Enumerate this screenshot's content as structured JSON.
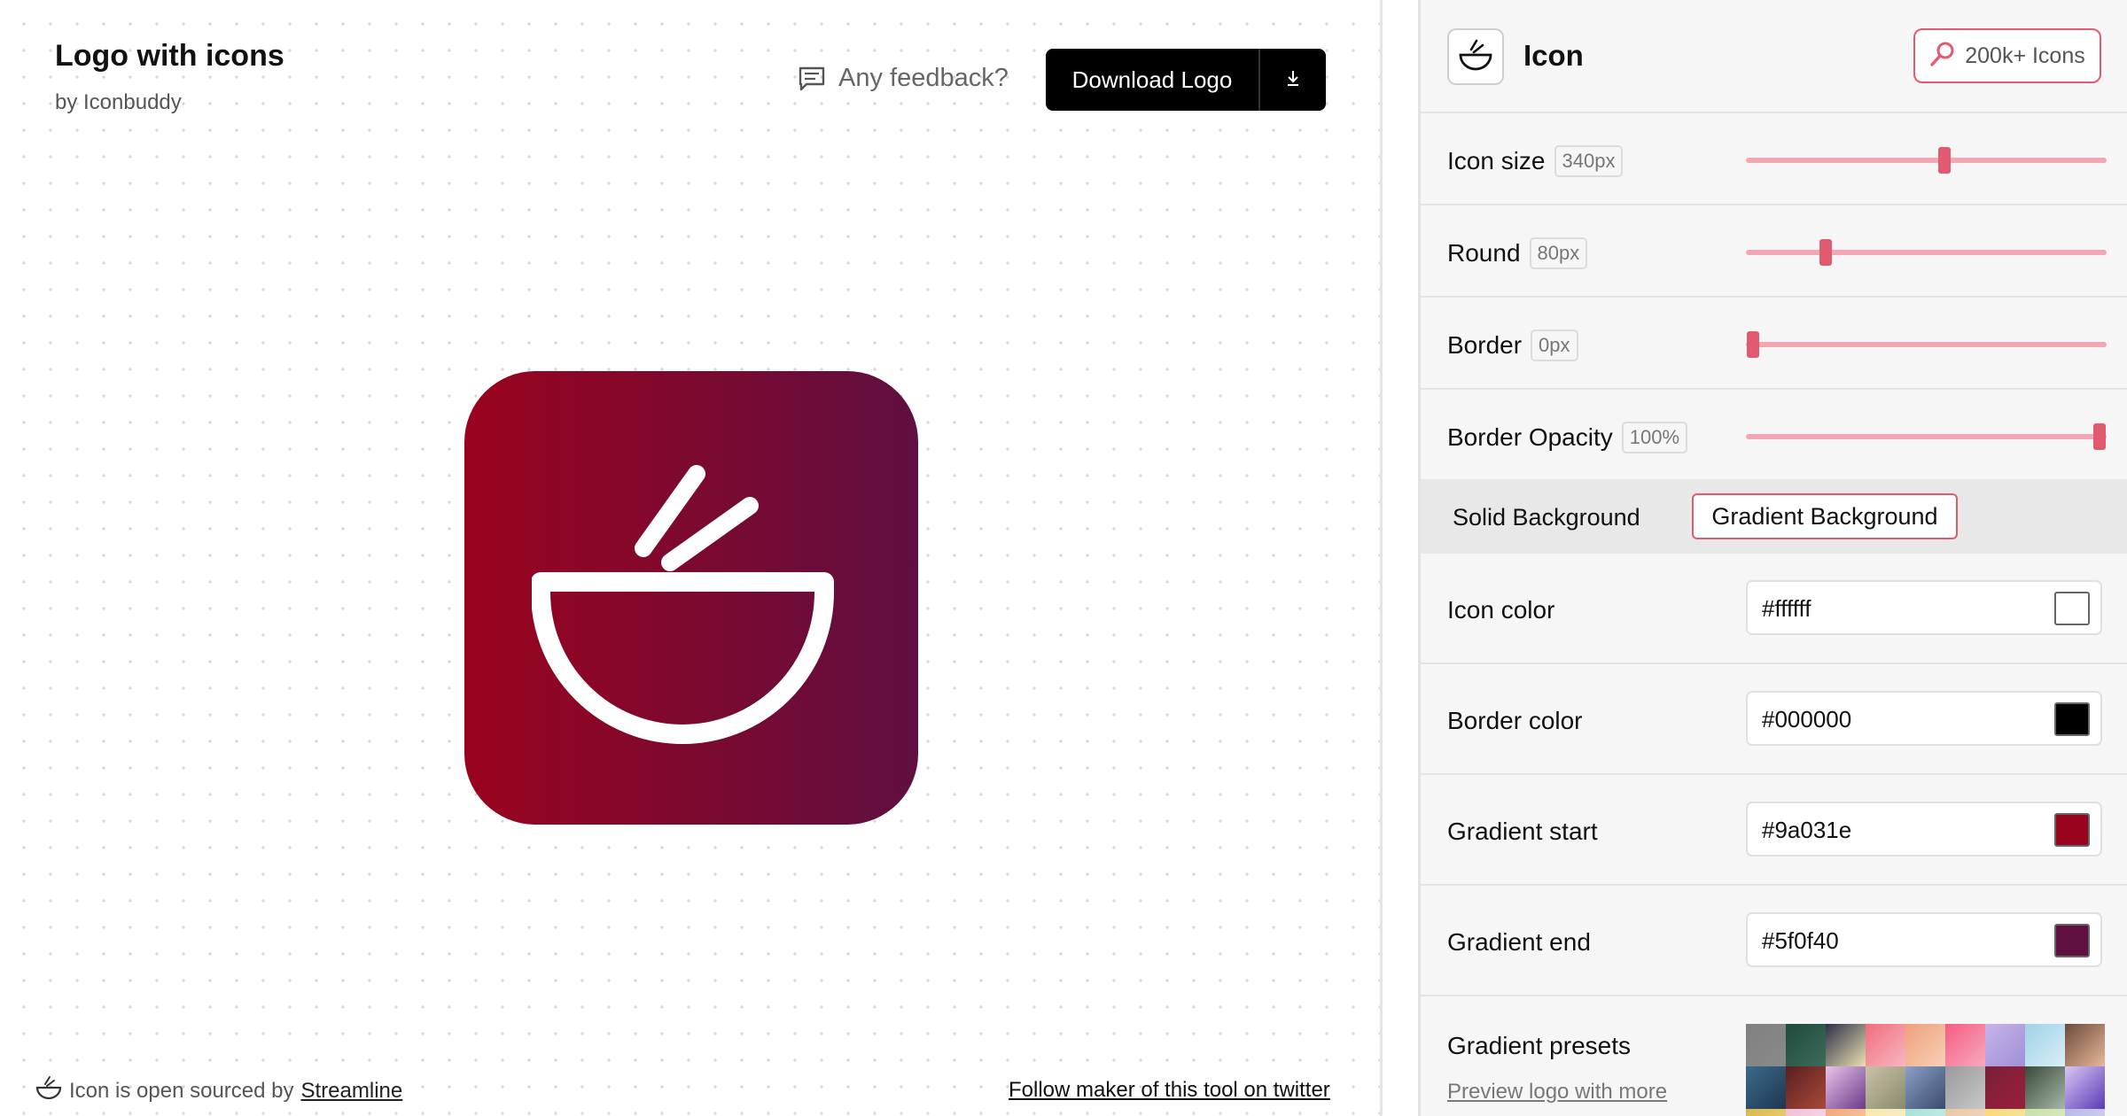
{
  "app": {
    "title": "Logo with icons",
    "byline": "by Iconbuddy",
    "feedback_label": "Any feedback?",
    "download_label": "Download Logo"
  },
  "footer": {
    "credit_prefix": "Icon is open sourced by",
    "credit_link": "Streamline",
    "twitter_link": "Follow maker of this tool on twitter"
  },
  "sidebar": {
    "header": {
      "title": "Icon",
      "icons_button": "200k+ Icons"
    },
    "sliders": [
      {
        "label": "Icon size",
        "value": "340px",
        "fraction": 0.55
      },
      {
        "label": "Round",
        "value": "80px",
        "fraction": 0.22
      },
      {
        "label": "Border",
        "value": "0px",
        "fraction": 0.02
      },
      {
        "label": "Border Opacity",
        "value": "100%",
        "fraction": 0.98
      }
    ],
    "background_tabs": {
      "solid": "Solid Background",
      "gradient": "Gradient Background",
      "active": "gradient"
    },
    "colors": [
      {
        "label": "Icon color",
        "value": "#ffffff"
      },
      {
        "label": "Border color",
        "value": "#000000"
      },
      {
        "label": "Gradient start",
        "value": "#9a031e"
      },
      {
        "label": "Gradient end",
        "value": "#5f0f40"
      }
    ],
    "presets": {
      "label": "Gradient presets",
      "link": "Preview logo with more",
      "swatches": [
        [
          "#808080",
          "#8a8a8a"
        ],
        [
          "#1f4a3c",
          "#3d6b5a"
        ],
        [
          "#2e2e4a",
          "#e9e2b0"
        ],
        [
          "#f26d7d",
          "#f7b7c0"
        ],
        [
          "#f0a07a",
          "#f7d0b8"
        ],
        [
          "#f55d80",
          "#f7a9bf"
        ],
        [
          "#c7b4e8",
          "#9f8fd8"
        ],
        [
          "#9fd2e8",
          "#d9eef6"
        ],
        [
          "#6b4a3a",
          "#e8b89a"
        ],
        [
          "#3a6b8a",
          "#1f3650"
        ],
        [
          "#5a1f1f",
          "#a84a3a"
        ],
        [
          "#e8c4e8",
          "#6b3a8a"
        ],
        [
          "#c9c2a8",
          "#8a8a6b"
        ],
        [
          "#8aa0c8",
          "#3a4a6b"
        ],
        [
          "#9a9a9a",
          "#c8c8c8"
        ],
        [
          "#7a1f3a",
          "#9a1f3a"
        ],
        [
          "#3a4a3a",
          "#a8b8a8"
        ],
        [
          "#d8c8f0",
          "#5a3ab8"
        ],
        [
          "#d8b850",
          "#f0d878"
        ],
        [
          "#f0c0d8",
          "#f8e0ec"
        ],
        [
          "#f0a878",
          "#f8d0b0"
        ],
        [
          "#f8e8b0",
          "#f8f0d0"
        ],
        [
          "#a8e0d8",
          "#d0f0e8"
        ],
        [
          "#e8c8a8",
          "#f0dcc8"
        ],
        [
          "#f8d878",
          "#f8e8b0"
        ],
        [
          "#c8e0a8",
          "#e0f0c8"
        ],
        [
          "#b8b8e8",
          "#d8d8f8"
        ]
      ]
    }
  },
  "preview": {
    "gradient_start": "#9a031e",
    "gradient_end": "#5f0f40",
    "icon_color": "#ffffff",
    "icon_name": "bowl-chopsticks-icon"
  }
}
